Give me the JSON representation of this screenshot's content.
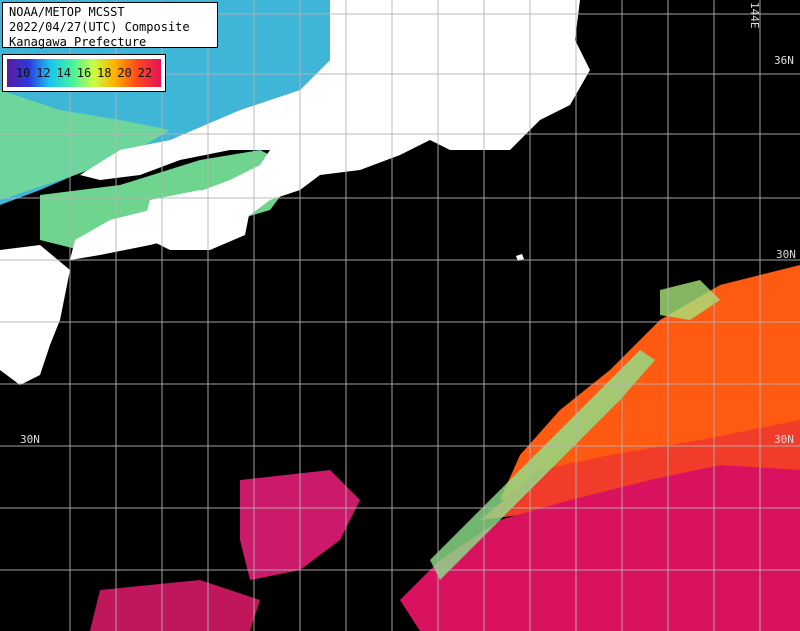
{
  "title": {
    "line1": "NOAA/METOP MCSST",
    "line2": "2022/04/27(UTC) Composite",
    "line3": "Kanagawa Prefecture"
  },
  "legend": {
    "labels": [
      "10",
      "12",
      "14",
      "16",
      "18",
      "20",
      "22"
    ],
    "colors": [
      "#5a1aa0",
      "#2a3adc",
      "#19c6f0",
      "#44f0a0",
      "#c8ff44",
      "#ffb000",
      "#ff4a1a",
      "#e3135a"
    ]
  },
  "geo_labels": {
    "lat_top": "36N",
    "lat_mid": "30N",
    "lat_mid_left": "30N",
    "lat_right_mid": "30N",
    "lon_top": "144E"
  },
  "colors": {
    "ocean_no_data": "#000000",
    "land": "#ffffff",
    "grid": "#b4b4b4",
    "sst_cool_coast": "#8de28a",
    "sst_warm_orange": "#ff5a12",
    "sst_hot_magenta": "#d8125e"
  }
}
